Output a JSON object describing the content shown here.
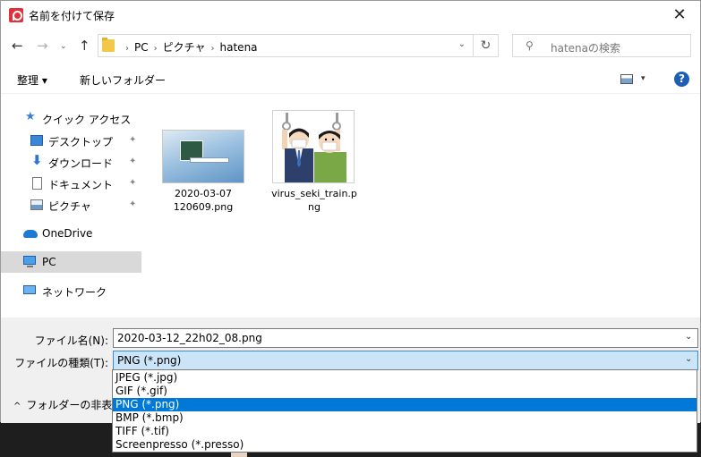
{
  "window": {
    "title": "名前を付けて保存",
    "close_glyph": "✕"
  },
  "nav": {
    "back": "←",
    "forward": "→",
    "recent": "⌄",
    "up": "↑",
    "breadcrumb": [
      "PC",
      "ピクチャ",
      "hatena"
    ],
    "address_dropdown": "⌄",
    "refresh": "↻",
    "search_placeholder": "hatenaの検索",
    "search_glyph": "⚲"
  },
  "toolbar": {
    "organize": "整理 ▾",
    "new_folder": "新しいフォルダー",
    "view_dropdown": "▾",
    "help": "?"
  },
  "sidebar": {
    "items": [
      {
        "label": "クイック アクセス",
        "icon": "star-icon",
        "pinned": false
      },
      {
        "label": "デスクトップ",
        "icon": "desktop-icon",
        "pinned": true
      },
      {
        "label": "ダウンロード",
        "icon": "download-icon",
        "pinned": true
      },
      {
        "label": "ドキュメント",
        "icon": "document-icon",
        "pinned": true
      },
      {
        "label": "ピクチャ",
        "icon": "pictures-icon",
        "pinned": true
      },
      {
        "label": "OneDrive",
        "icon": "cloud-icon",
        "pinned": false
      },
      {
        "label": "PC",
        "icon": "pc-icon",
        "pinned": false,
        "selected": true
      },
      {
        "label": "ネットワーク",
        "icon": "network-icon",
        "pinned": false
      }
    ],
    "pin_glyph": "📌"
  },
  "files": [
    {
      "name_line1": "2020-03-07",
      "name_line2": "120609.png",
      "icon": "screenshot-thumbnail"
    },
    {
      "name_line1": "virus_seki_train.p",
      "name_line2": "ng",
      "icon": "illustration-thumbnail"
    }
  ],
  "form": {
    "filename_label": "ファイル名(N):",
    "filename_value": "2020-03-12_22h02_08.png",
    "filetype_label": "ファイルの種類(T):",
    "filetype_value": "PNG (*.png)",
    "dropdown_glyph": "⌄",
    "hide_folders": "フォルダーの非表示",
    "hide_chevron": "^"
  },
  "filetype_options": [
    {
      "label": "JPEG (*.jpg)",
      "selected": false
    },
    {
      "label": "GIF (*.gif)",
      "selected": false
    },
    {
      "label": "PNG (*.png)",
      "selected": true
    },
    {
      "label": "BMP (*.bmp)",
      "selected": false
    },
    {
      "label": "TIFF (*.tif)",
      "selected": false
    },
    {
      "label": "Screenpresso (*.presso)",
      "selected": false
    }
  ]
}
